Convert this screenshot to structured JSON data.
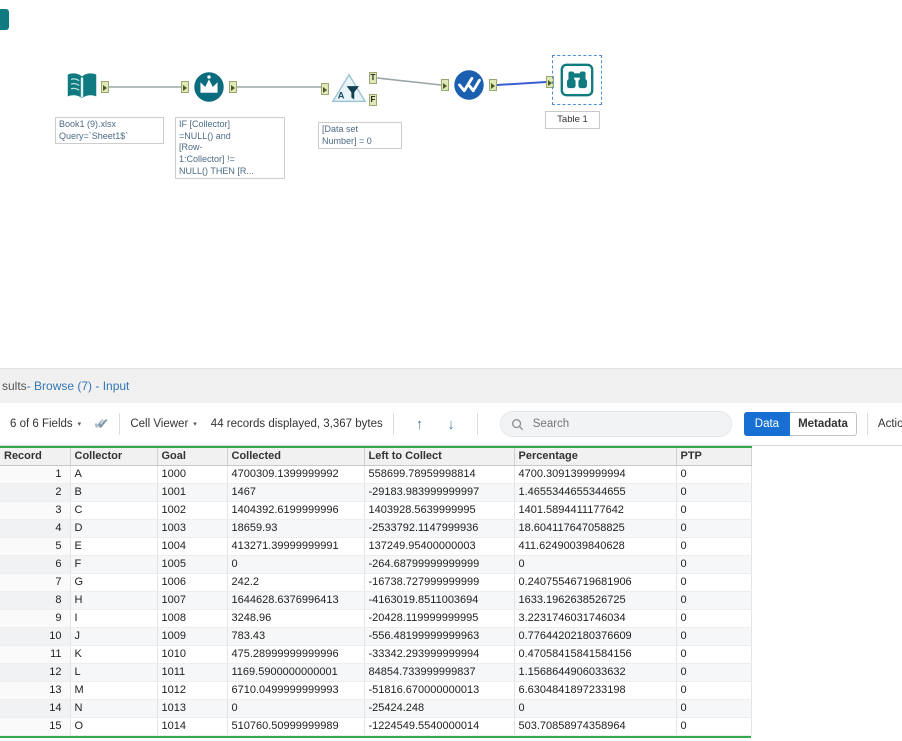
{
  "canvas": {
    "tools": {
      "input": {
        "annotation": "Book1 (9).xlsx\nQuery=`Sheet1$`"
      },
      "formula": {
        "annotation": "IF [Collector]\n=NULL() and\n[Row-\n1:Collector] !=\nNULL() THEN [R..."
      },
      "filter": {
        "annotation": "[Data set\nNumber] = 0",
        "true_label": "T",
        "false_label": "F"
      },
      "browse": {
        "label": "Table 1"
      }
    }
  },
  "results": {
    "title": {
      "prefix": "sults",
      "rest": " - Browse (7) - Input"
    },
    "toolbar": {
      "fields": "6 of 6 Fields",
      "cell_viewer": "Cell Viewer",
      "records_info": "44 records displayed, 3,367 bytes",
      "search_placeholder": "Search",
      "data": "Data",
      "metadata": "Metadata",
      "actions": "Actions"
    },
    "table": {
      "columns": [
        "Record",
        "Collector",
        "Goal",
        "Collected",
        "Left to Collect",
        "Percentage",
        "PTP"
      ],
      "rows": [
        [
          "1",
          "A",
          "1000",
          "4700309.1399999992",
          "558699.78959998814",
          "4700.3091399999994",
          "0"
        ],
        [
          "2",
          "B",
          "1001",
          "1467",
          "-29183.983999999997",
          "1.4655344655344655",
          "0"
        ],
        [
          "3",
          "C",
          "1002",
          "1404392.6199999996",
          "1403928.5639999995",
          "1401.5894411177642",
          "0"
        ],
        [
          "4",
          "D",
          "1003",
          "18659.93",
          "-2533792.1147999936",
          "18.604117647058825",
          "0"
        ],
        [
          "5",
          "E",
          "1004",
          "413271.39999999991",
          "137249.95400000003",
          "411.62490039840628",
          "0"
        ],
        [
          "6",
          "F",
          "1005",
          "0",
          "-264.68799999999999",
          "0",
          "0"
        ],
        [
          "7",
          "G",
          "1006",
          "242.2",
          "-16738.727999999999",
          "0.24075546719681906",
          "0"
        ],
        [
          "8",
          "H",
          "1007",
          "1644628.6376996413",
          "-4163019.8511003694",
          "1633.1962638526725",
          "0"
        ],
        [
          "9",
          "I",
          "1008",
          "3248.96",
          "-20428.119999999995",
          "3.2231746031746034",
          "0"
        ],
        [
          "10",
          "J",
          "1009",
          "783.43",
          "-556.48199999999963",
          "0.77644202180376609",
          "0"
        ],
        [
          "11",
          "K",
          "1010",
          "475.28999999999996",
          "-33342.293999999994",
          "0.47058415841584156",
          "0"
        ],
        [
          "12",
          "L",
          "1011",
          "1169.5900000000001",
          "84854.733999999837",
          "1.1568644906033632",
          "0"
        ],
        [
          "13",
          "M",
          "1012",
          "6710.0499999999993",
          "-51816.670000000013",
          "6.6304841897233198",
          "0"
        ],
        [
          "14",
          "N",
          "1013",
          "0",
          "-25424.248",
          "0",
          "0"
        ],
        [
          "15",
          "O",
          "1014",
          "510760.50999999989",
          "-1224549.5540000014",
          "503.70858974358964",
          "0"
        ]
      ]
    }
  },
  "colors": {
    "accent_teal": "#0f7b80",
    "accent_blue": "#176fd4",
    "grid_green": "#31a94c",
    "selection_blue": "#4c8fd6"
  }
}
